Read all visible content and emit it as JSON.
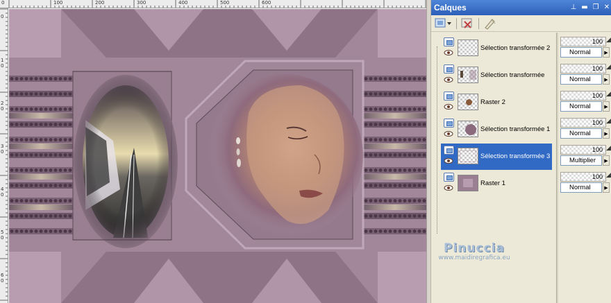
{
  "ruler": {
    "top_labels": [
      "0",
      "100",
      "200",
      "300",
      "400",
      "500",
      "600"
    ],
    "left_labels": [
      "0",
      "1",
      "0",
      "2",
      "0",
      "3",
      "0",
      "4",
      "0",
      "5",
      "0",
      "6",
      "0"
    ]
  },
  "panel": {
    "title": "Calques",
    "title_icons": [
      "pin-icon",
      "minimize-icon",
      "restore-icon",
      "close-icon"
    ],
    "title_glyphs": [
      "⊥",
      "▬",
      "❐",
      "✕"
    ]
  },
  "layers": [
    {
      "name": "Sélection transformée 2",
      "opacity": "100",
      "blend": "Normal",
      "selected": false,
      "thumb": "empty"
    },
    {
      "name": "Sélection transformée",
      "opacity": "100",
      "blend": "Normal",
      "selected": false,
      "thumb": "figure"
    },
    {
      "name": "Raster 2",
      "opacity": "100",
      "blend": "Normal",
      "selected": false,
      "thumb": "dot"
    },
    {
      "name": "Sélection transformée 1",
      "opacity": "100",
      "blend": "Normal",
      "selected": false,
      "thumb": "blob"
    },
    {
      "name": "Sélection transformée 3",
      "opacity": "100",
      "blend": "Multiplier",
      "selected": true,
      "thumb": "empty"
    },
    {
      "name": "Raster 1",
      "opacity": "100",
      "blend": "Normal",
      "selected": false,
      "thumb": "fill"
    }
  ],
  "watermark": {
    "name": "Pinuccia",
    "url": "www.maidiregrafica.eu"
  },
  "colors": {
    "canvas_bg": "#a2879a",
    "selection": "#316ac5",
    "titlebar": "#2c5fb8"
  }
}
